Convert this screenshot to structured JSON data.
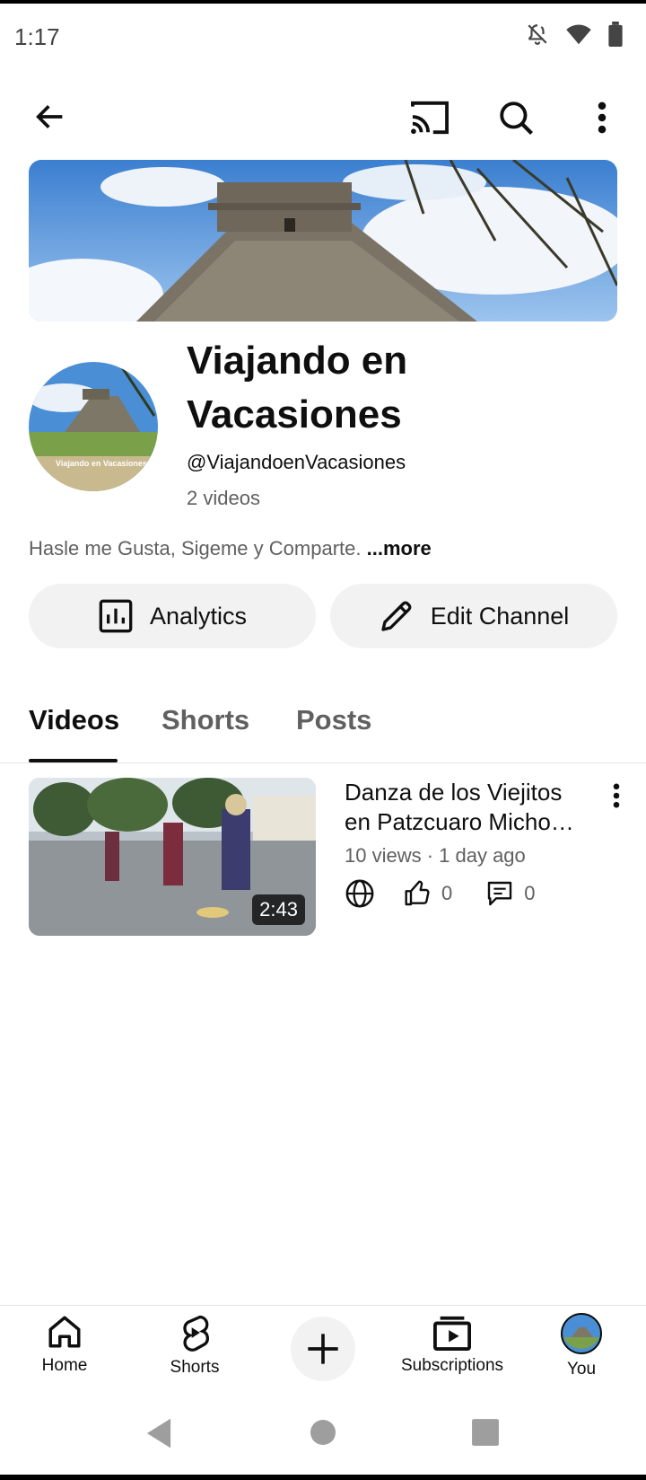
{
  "status_bar": {
    "time": "1:17",
    "icons": [
      "bell-off-icon",
      "wifi-icon",
      "battery-icon"
    ]
  },
  "app_bar": {
    "icons": [
      "back-arrow-icon",
      "cast-icon",
      "search-icon",
      "more-vert-icon"
    ]
  },
  "channel": {
    "name": "Viajando en Vacasiones",
    "handle": "@ViajandoenVacasiones",
    "video_count": "2 videos",
    "description": "Hasle me Gusta, Sigeme y Comparte.",
    "more_label": "...more",
    "avatar_watermark": "Viajando en Vacasiones"
  },
  "actions": {
    "analytics_label": "Analytics",
    "edit_label": "Edit Channel"
  },
  "tabs": [
    {
      "label": "Videos",
      "active": true
    },
    {
      "label": "Shorts",
      "active": false
    },
    {
      "label": "Posts",
      "active": false
    }
  ],
  "videos": [
    {
      "title": "Danza de los Viejitos en Patzcuaro Micho…",
      "meta": "10 views · 1 day ago",
      "duration": "2:43",
      "likes": "0",
      "comments": "0",
      "visibility_icon": "globe-icon"
    }
  ],
  "bottom_nav": {
    "home": "Home",
    "shorts": "Shorts",
    "create_icon": "plus-icon",
    "subscriptions": "Subscriptions",
    "you": "You"
  },
  "colors": {
    "text_primary": "#0f0f0f",
    "text_secondary": "#606060",
    "pill_bg": "#f2f2f2"
  }
}
